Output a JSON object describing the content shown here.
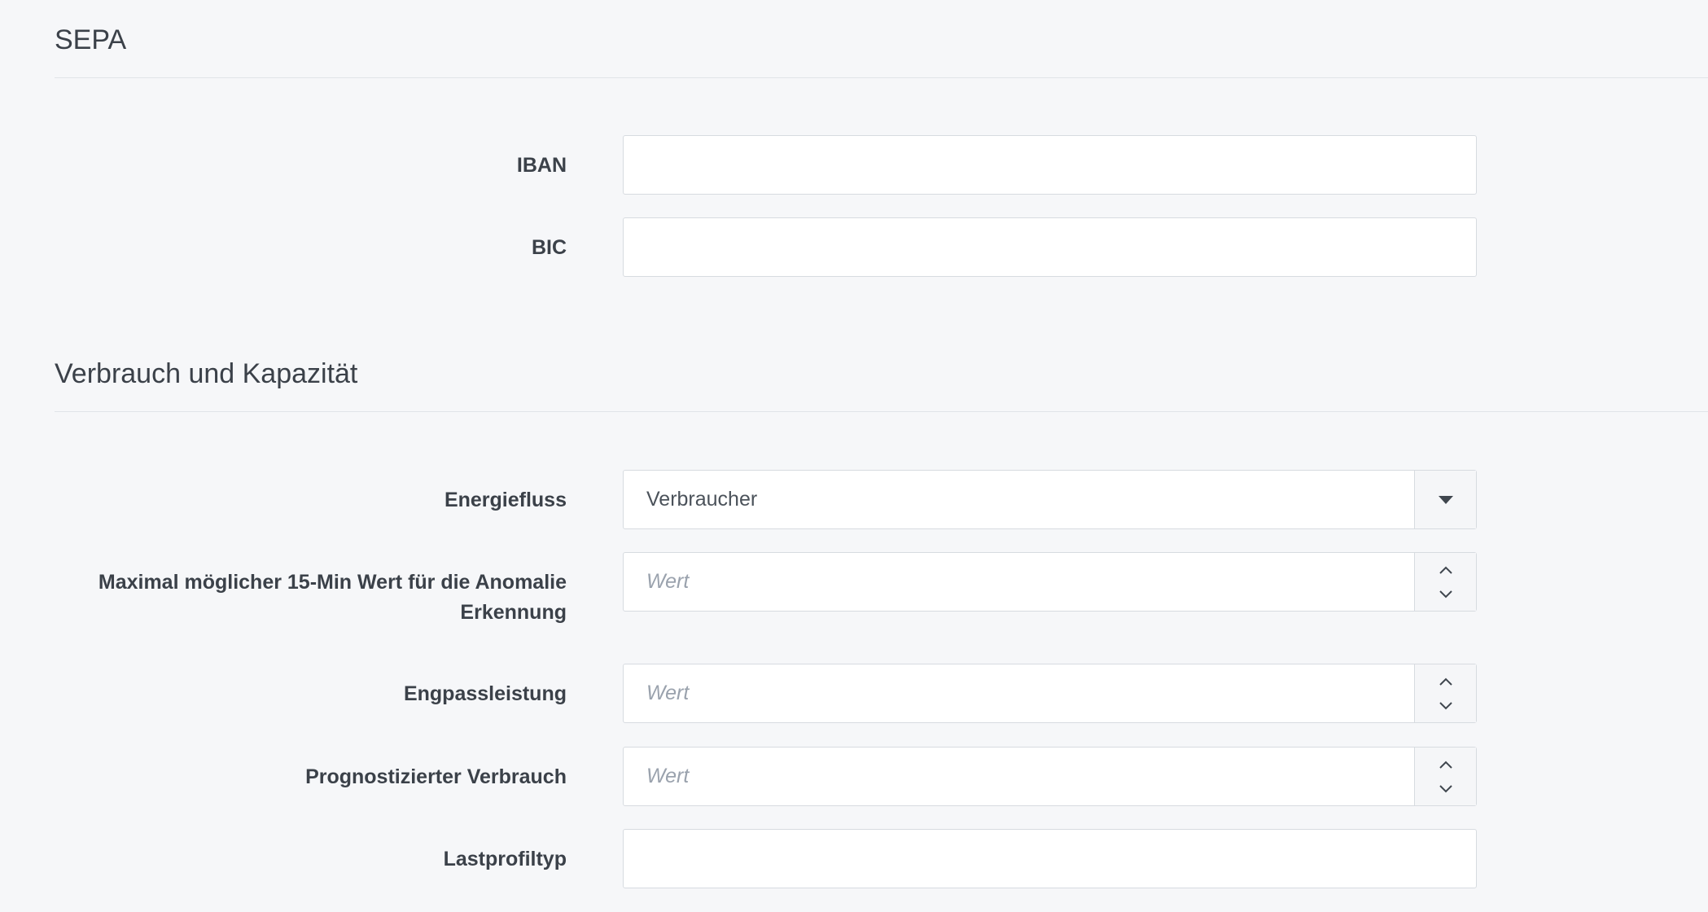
{
  "sepa": {
    "title": "SEPA",
    "iban_label": "IBAN",
    "iban_value": "",
    "bic_label": "BIC",
    "bic_value": ""
  },
  "verbrauch": {
    "title": "Verbrauch und Kapazität",
    "energiefluss_label": "Energiefluss",
    "energiefluss_value": "Verbraucher",
    "anomalie_label": "Maximal möglicher 15-Min Wert für die Anomalie Erkennung",
    "anomalie_placeholder": "Wert",
    "engpass_label": "Engpassleistung",
    "engpass_placeholder": "Wert",
    "prognose_label": "Prognostizierter Verbrauch",
    "prognose_placeholder": "Wert",
    "lastprofil_label": "Lastprofiltyp",
    "lastprofil_value": ""
  },
  "icons": {
    "select_caret": "caret-down-icon",
    "spin_up": "chevron-up-icon",
    "spin_down": "chevron-down-icon"
  }
}
